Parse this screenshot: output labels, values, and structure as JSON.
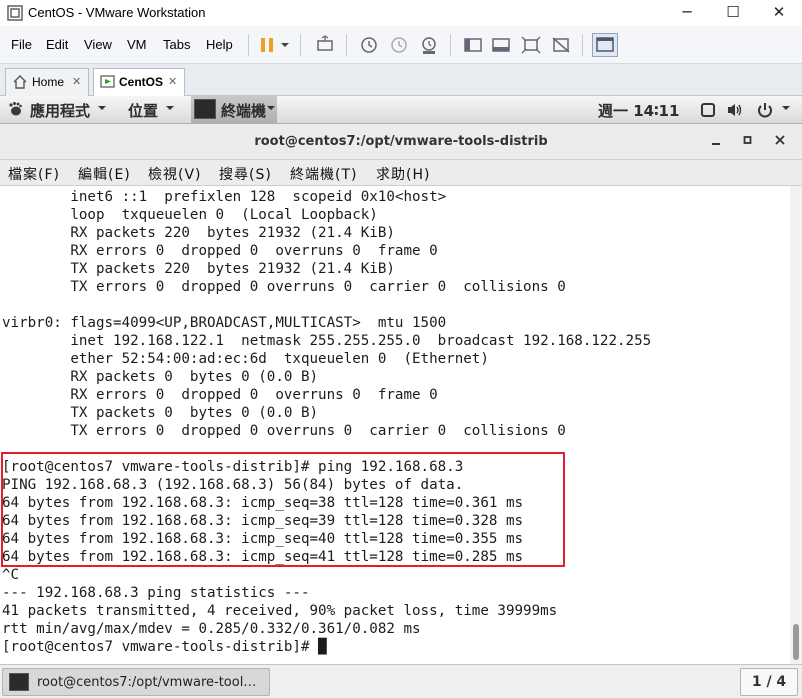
{
  "window": {
    "title": "CentOS - VMware Workstation",
    "minimize": "─",
    "maximize": "☐",
    "close": "✕"
  },
  "vm_menu": [
    "File",
    "Edit",
    "View",
    "VM",
    "Tabs",
    "Help"
  ],
  "tabs": [
    {
      "label": "Home",
      "close": "✕"
    },
    {
      "label": "CentOS",
      "close": "✕"
    }
  ],
  "gnome": {
    "apps": "應用程式",
    "places": "位置",
    "terminal": "終端機",
    "clock": "週一 14∶11"
  },
  "terminal": {
    "title": "root@centos7:/opt/vmware-tools-distrib",
    "menu": [
      "檔案(F)",
      "編輯(E)",
      "檢視(V)",
      "搜尋(S)",
      "終端機(T)",
      "求助(H)"
    ],
    "lines": [
      "        inet6 ::1  prefixlen 128  scopeid 0x10<host>",
      "        loop  txqueuelen 0  (Local Loopback)",
      "        RX packets 220  bytes 21932 (21.4 KiB)",
      "        RX errors 0  dropped 0  overruns 0  frame 0",
      "        TX packets 220  bytes 21932 (21.4 KiB)",
      "        TX errors 0  dropped 0 overruns 0  carrier 0  collisions 0",
      "",
      "virbr0: flags=4099<UP,BROADCAST,MULTICAST>  mtu 1500",
      "        inet 192.168.122.1  netmask 255.255.255.0  broadcast 192.168.122.255",
      "        ether 52:54:00:ad:ec:6d  txqueuelen 0  (Ethernet)",
      "        RX packets 0  bytes 0 (0.0 B)",
      "        RX errors 0  dropped 0  overruns 0  frame 0",
      "        TX packets 0  bytes 0 (0.0 B)",
      "        TX errors 0  dropped 0 overruns 0  carrier 0  collisions 0",
      "",
      "[root@centos7 vmware-tools-distrib]# ping 192.168.68.3",
      "PING 192.168.68.3 (192.168.68.3) 56(84) bytes of data.",
      "64 bytes from 192.168.68.3: icmp_seq=38 ttl=128 time=0.361 ms",
      "64 bytes from 192.168.68.3: icmp_seq=39 ttl=128 time=0.328 ms",
      "64 bytes from 192.168.68.3: icmp_seq=40 ttl=128 time=0.355 ms",
      "64 bytes from 192.168.68.3: icmp_seq=41 ttl=128 time=0.285 ms",
      "^C",
      "--- 192.168.68.3 ping statistics ---",
      "41 packets transmitted, 4 received, 90% packet loss, time 39999ms",
      "rtt min/avg/max/mdev = 0.285/0.332/0.361/0.082 ms",
      "[root@centos7 vmware-tools-distrib]# "
    ],
    "cursor": "█"
  },
  "taskbar": {
    "item": "root@centos7:/opt/vmware-tool…",
    "pager": "1 / 4"
  },
  "colors": {
    "highlight": "#e0202a",
    "vm_accent": "#f0a020"
  }
}
